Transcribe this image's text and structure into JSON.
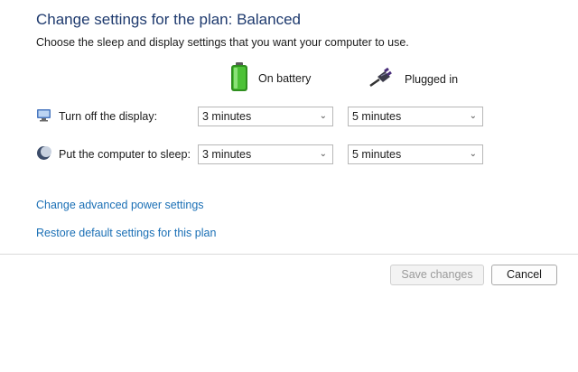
{
  "header": {
    "title": "Change settings for the plan: Balanced",
    "subtitle": "Choose the sleep and display settings that you want your computer to use."
  },
  "columns": {
    "battery": {
      "label": "On battery",
      "icon": "battery-icon"
    },
    "plugged": {
      "label": "Plugged in",
      "icon": "power-plug-icon"
    }
  },
  "rows": {
    "display": {
      "label": "Turn off the display:",
      "icon": "monitor-icon",
      "battery_value": "3 minutes",
      "plugged_value": "5 minutes"
    },
    "sleep": {
      "label": "Put the computer to sleep:",
      "icon": "sleep-moon-icon",
      "battery_value": "3 minutes",
      "plugged_value": "5 minutes"
    }
  },
  "links": {
    "advanced": "Change advanced power settings",
    "restore": "Restore default settings for this plan"
  },
  "buttons": {
    "save": "Save changes",
    "cancel": "Cancel"
  },
  "colors": {
    "title": "#1e3a6e",
    "link": "#1a6fb5",
    "battery_green": "#3fae2a"
  }
}
